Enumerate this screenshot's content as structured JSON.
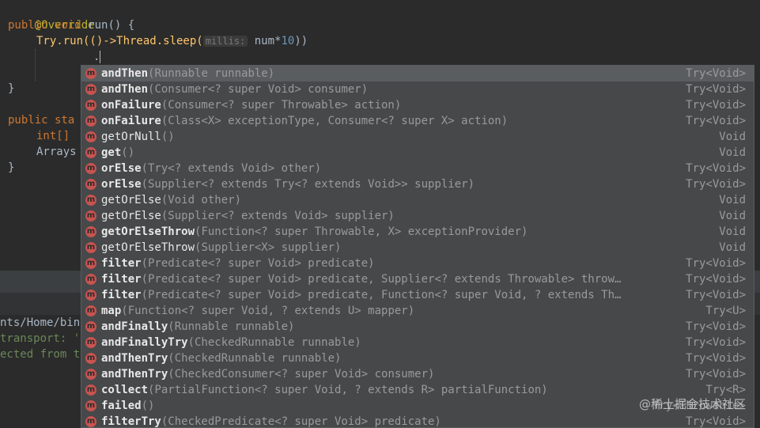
{
  "editor": {
    "line1": "@Override",
    "line2_kw1": "public",
    "line2_kw2": "void",
    "line2_rest": " run() {",
    "line3_call": "Try.run(()->Thread.sleep(",
    "line3_hint": "millis:",
    "line3_expr": " num*",
    "line3_num": "10",
    "line3_end": "))",
    "line4_dot": ".",
    "line6": "}",
    "line8": "public sta",
    "line9": "int[]",
    "line10": "Arrays",
    "line11": "}"
  },
  "console": {
    "path": "nts/Home/bin",
    "line2": "transport: '",
    "line3": "ected from t"
  },
  "completion": {
    "items": [
      {
        "name": "andThen",
        "params": "(Runnable runnable)",
        "ret": "Try<Void>",
        "bold": true
      },
      {
        "name": "andThen",
        "params": "(Consumer<? super Void> consumer)",
        "ret": "Try<Void>",
        "bold": true
      },
      {
        "name": "onFailure",
        "params": "(Consumer<? super Throwable> action)",
        "ret": "Try<Void>",
        "bold": true
      },
      {
        "name": "onFailure",
        "params": "(Class<X> exceptionType, Consumer<? super X> action)",
        "ret": "Try<Void>",
        "bold": true
      },
      {
        "name": "getOrNull",
        "params": "()",
        "ret": "Void",
        "bold": false
      },
      {
        "name": "get",
        "params": "()",
        "ret": "Void",
        "bold": true
      },
      {
        "name": "orElse",
        "params": "(Try<? extends Void> other)",
        "ret": "Try<Void>",
        "bold": true
      },
      {
        "name": "orElse",
        "params": "(Supplier<? extends Try<? extends Void>> supplier)",
        "ret": "Try<Void>",
        "bold": true
      },
      {
        "name": "getOrElse",
        "params": "(Void other)",
        "ret": "Void",
        "bold": false
      },
      {
        "name": "getOrElse",
        "params": "(Supplier<? extends Void> supplier)",
        "ret": "Void",
        "bold": false
      },
      {
        "name": "getOrElseThrow",
        "params": "(Function<? super Throwable, X> exceptionProvider)",
        "ret": "Void",
        "bold": true
      },
      {
        "name": "getOrElseThrow",
        "params": "(Supplier<X> supplier)",
        "ret": "Void",
        "bold": false
      },
      {
        "name": "filter",
        "params": "(Predicate<? super Void> predicate)",
        "ret": "Try<Void>",
        "bold": true
      },
      {
        "name": "filter",
        "params": "(Predicate<? super Void> predicate, Supplier<? extends Throwable> throw…",
        "ret": "Try<Void>",
        "bold": true
      },
      {
        "name": "filter",
        "params": "(Predicate<? super Void> predicate, Function<? super Void, ? extends Th…",
        "ret": "Try<Void>",
        "bold": true
      },
      {
        "name": "map",
        "params": "(Function<? super Void, ? extends U> mapper)",
        "ret": "Try<U>",
        "bold": true
      },
      {
        "name": "andFinally",
        "params": "(Runnable runnable)",
        "ret": "Try<Void>",
        "bold": true
      },
      {
        "name": "andFinallyTry",
        "params": "(CheckedRunnable runnable)",
        "ret": "Try<Void>",
        "bold": true
      },
      {
        "name": "andThenTry",
        "params": "(CheckedRunnable runnable)",
        "ret": "Try<Void>",
        "bold": true
      },
      {
        "name": "andThenTry",
        "params": "(CheckedConsumer<? super Void> consumer)",
        "ret": "Try<Void>",
        "bold": true
      },
      {
        "name": "collect",
        "params": "(PartialFunction<? super Void, ? extends R> partialFunction)",
        "ret": "Try<R>",
        "bold": true
      },
      {
        "name": "failed",
        "params": "()",
        "ret": "Try<Throwable>",
        "bold": true
      },
      {
        "name": "filterTry",
        "params": "(CheckedPredicate<? super Void> predicate)",
        "ret": "Try<Void>",
        "bold": true
      }
    ],
    "icon_letter": "m"
  },
  "watermark": "@稀土掘金技术社区"
}
